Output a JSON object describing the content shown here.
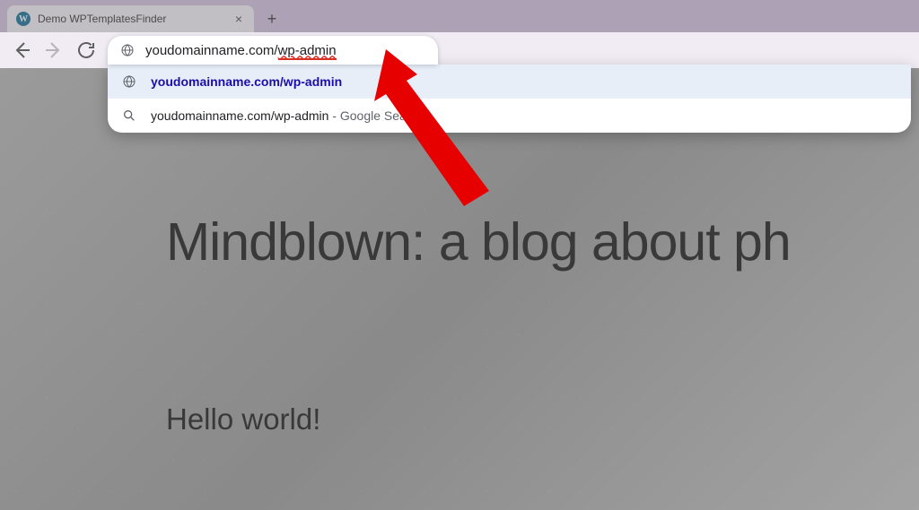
{
  "tab": {
    "title": "Demo WPTemplatesFinder",
    "favicon_letter": "W"
  },
  "toolbar": {
    "new_tab_glyph": "+",
    "close_glyph": "×"
  },
  "address": {
    "typed_prefix": "youdomainname.com/",
    "typed_underlined": "wp-admin"
  },
  "omnibox": {
    "rows": [
      {
        "text": "youdomainname.com/wp-admin",
        "suffix": ""
      },
      {
        "text": "youdomainname.com/wp-admin",
        "suffix": " - Google Search"
      }
    ]
  },
  "page": {
    "heading": "Mindblown: a blog about ph",
    "subheading": "Hello world!"
  }
}
